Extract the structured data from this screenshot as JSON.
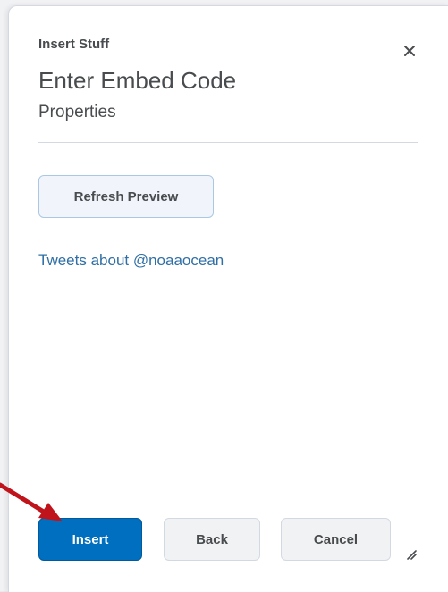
{
  "dialog": {
    "eyebrow": "Insert Stuff",
    "title": "Enter Embed Code",
    "subtitle": "Properties",
    "close_icon": "close-icon"
  },
  "content": {
    "refresh_label": "Refresh Preview",
    "embed_preview_link": "Tweets about @noaaocean"
  },
  "footer": {
    "insert_label": "Insert",
    "back_label": "Back",
    "cancel_label": "Cancel",
    "resize_icon": "resize-handle-icon"
  },
  "annotation": {
    "arrow_color": "#c0141c",
    "points_to": "insert-button"
  },
  "colors": {
    "primary": "#006fbf",
    "link": "#2f6fa5",
    "text": "#494c4e"
  }
}
